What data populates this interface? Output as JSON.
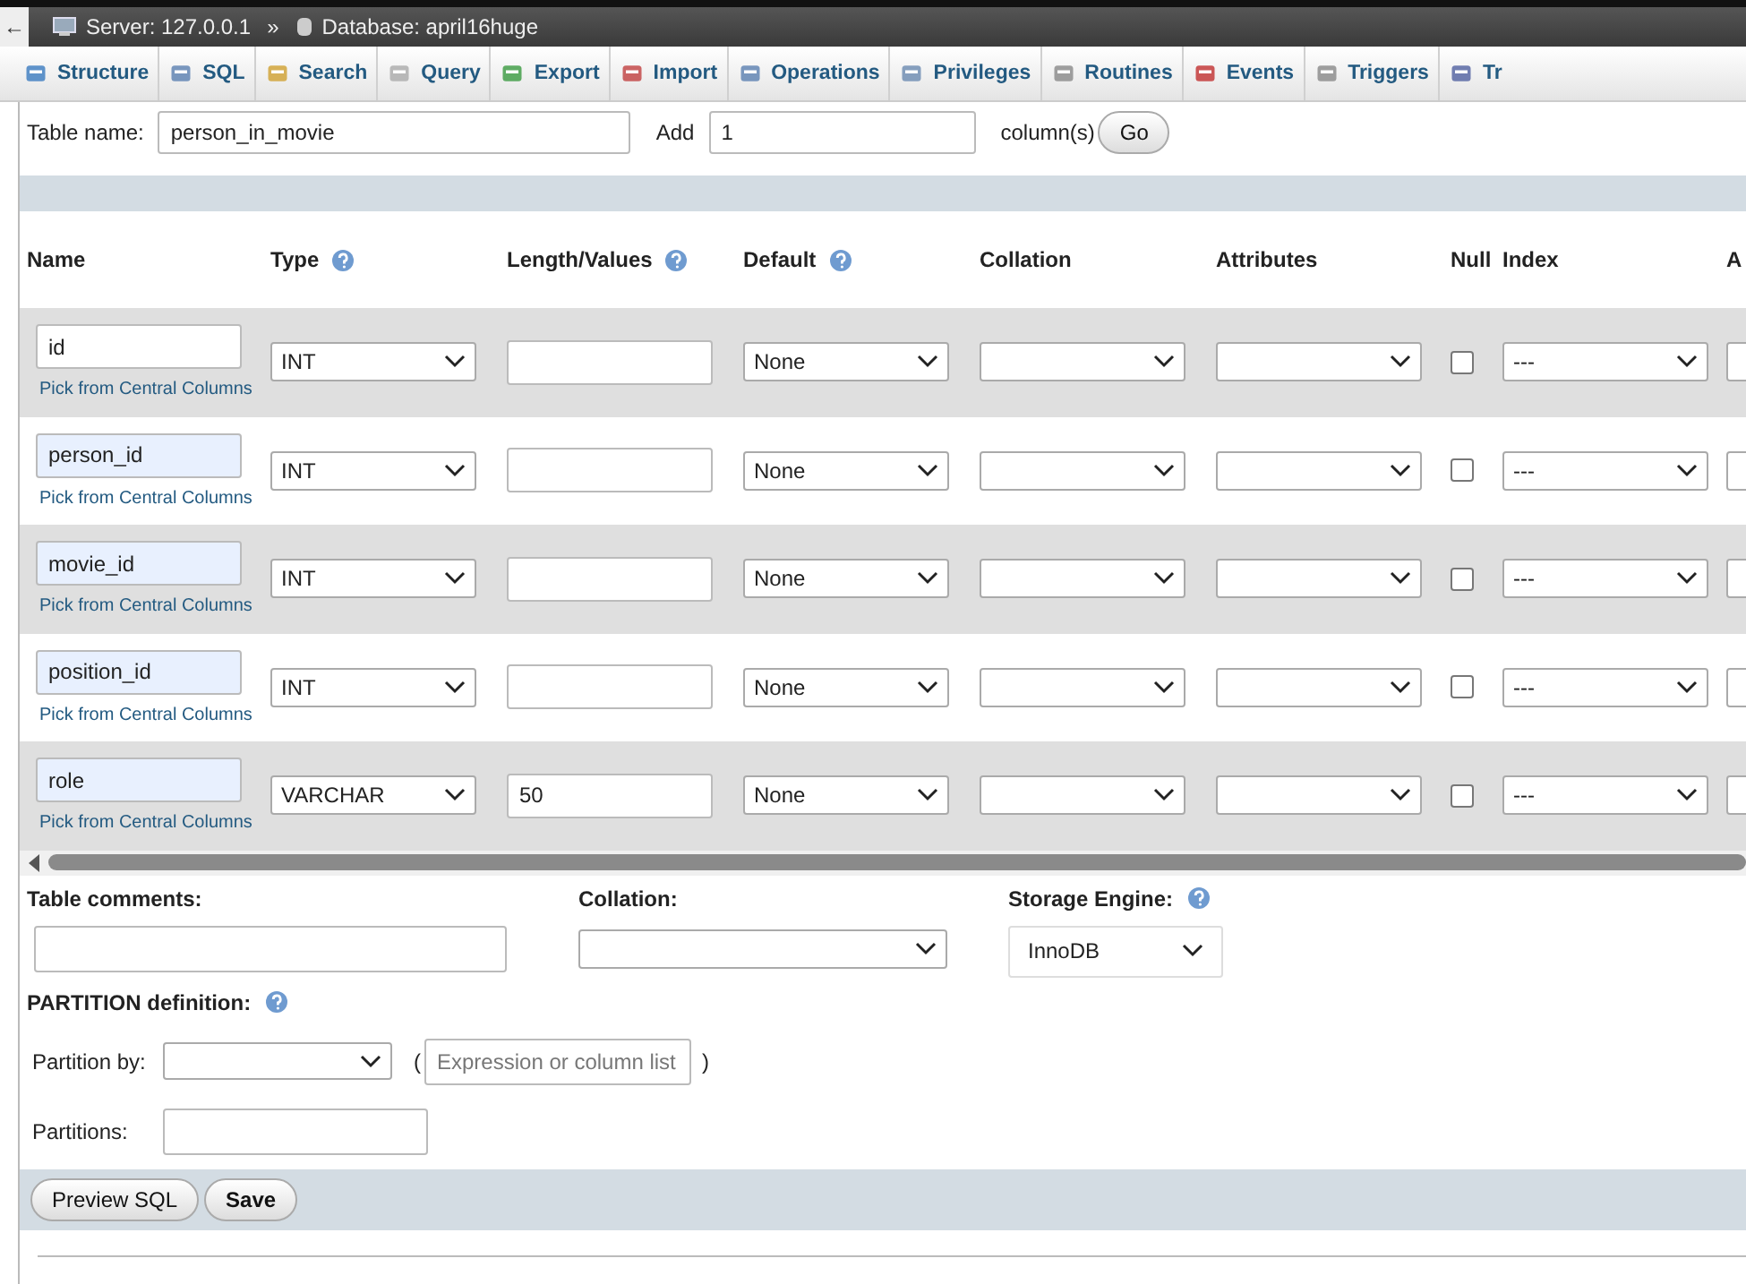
{
  "breadcrumb": {
    "back": "←",
    "server": "Server: 127.0.0.1",
    "separator": "»",
    "database": "Database: april16huge"
  },
  "tabs": [
    {
      "label": "Structure"
    },
    {
      "label": "SQL"
    },
    {
      "label": "Search"
    },
    {
      "label": "Query"
    },
    {
      "label": "Export"
    },
    {
      "label": "Import"
    },
    {
      "label": "Operations"
    },
    {
      "label": "Privileges"
    },
    {
      "label": "Routines"
    },
    {
      "label": "Events"
    },
    {
      "label": "Triggers"
    },
    {
      "label": "Tr"
    }
  ],
  "table_name": {
    "label": "Table name:",
    "value": "person_in_movie"
  },
  "add_columns": {
    "label": "Add",
    "value": "1",
    "suffix": "column(s)",
    "button": "Go"
  },
  "columns": [
    {
      "label": "Name",
      "kind": "plain"
    },
    {
      "label": "Type",
      "kind": "help"
    },
    {
      "label": "Length/Values",
      "kind": "help"
    },
    {
      "label": "Default",
      "kind": "help"
    },
    {
      "label": "Collation",
      "kind": "plain"
    },
    {
      "label": "Attributes",
      "kind": "plain"
    },
    {
      "label": "Null",
      "kind": "plain"
    },
    {
      "label": "Index",
      "kind": "plain"
    },
    {
      "label": "A",
      "kind": "plain"
    }
  ],
  "fields": [
    {
      "name": "id",
      "autofilled": false,
      "link": "Pick from Central Columns",
      "type": "INT",
      "default": "None",
      "null": false,
      "index": "---"
    },
    {
      "name": "person_id",
      "autofilled": true,
      "link": "Pick from Central Columns",
      "type": "INT",
      "default": "None",
      "null": false,
      "index": "---"
    },
    {
      "name": "movie_id",
      "autofilled": true,
      "link": "Pick from Central Columns",
      "type": "INT",
      "default": "None",
      "null": false,
      "index": "---"
    },
    {
      "name": "position_id",
      "autofilled": true,
      "link": "Pick from Central Columns",
      "type": "INT",
      "default": "None",
      "null": false,
      "index": "---"
    },
    {
      "name": "role",
      "autofilled": true,
      "link": "Pick from Central Columns",
      "type": "VARCHAR",
      "length": "50",
      "default": "None",
      "null": false,
      "index": "---"
    }
  ],
  "table_options": {
    "comments_label": "Table comments:",
    "collation_label": "Collation:",
    "engine_label": "Storage Engine:",
    "engine": "InnoDB"
  },
  "partition": {
    "title": "PARTITION definition:",
    "by_label": "Partition by:",
    "open": "(",
    "expression_placeholder": "Expression or column list",
    "close": ")",
    "partitions_label": "Partitions:"
  },
  "buttons": [
    {
      "label": "Preview SQL",
      "kind": "normal"
    },
    {
      "label": "Save",
      "kind": "primary"
    }
  ]
}
